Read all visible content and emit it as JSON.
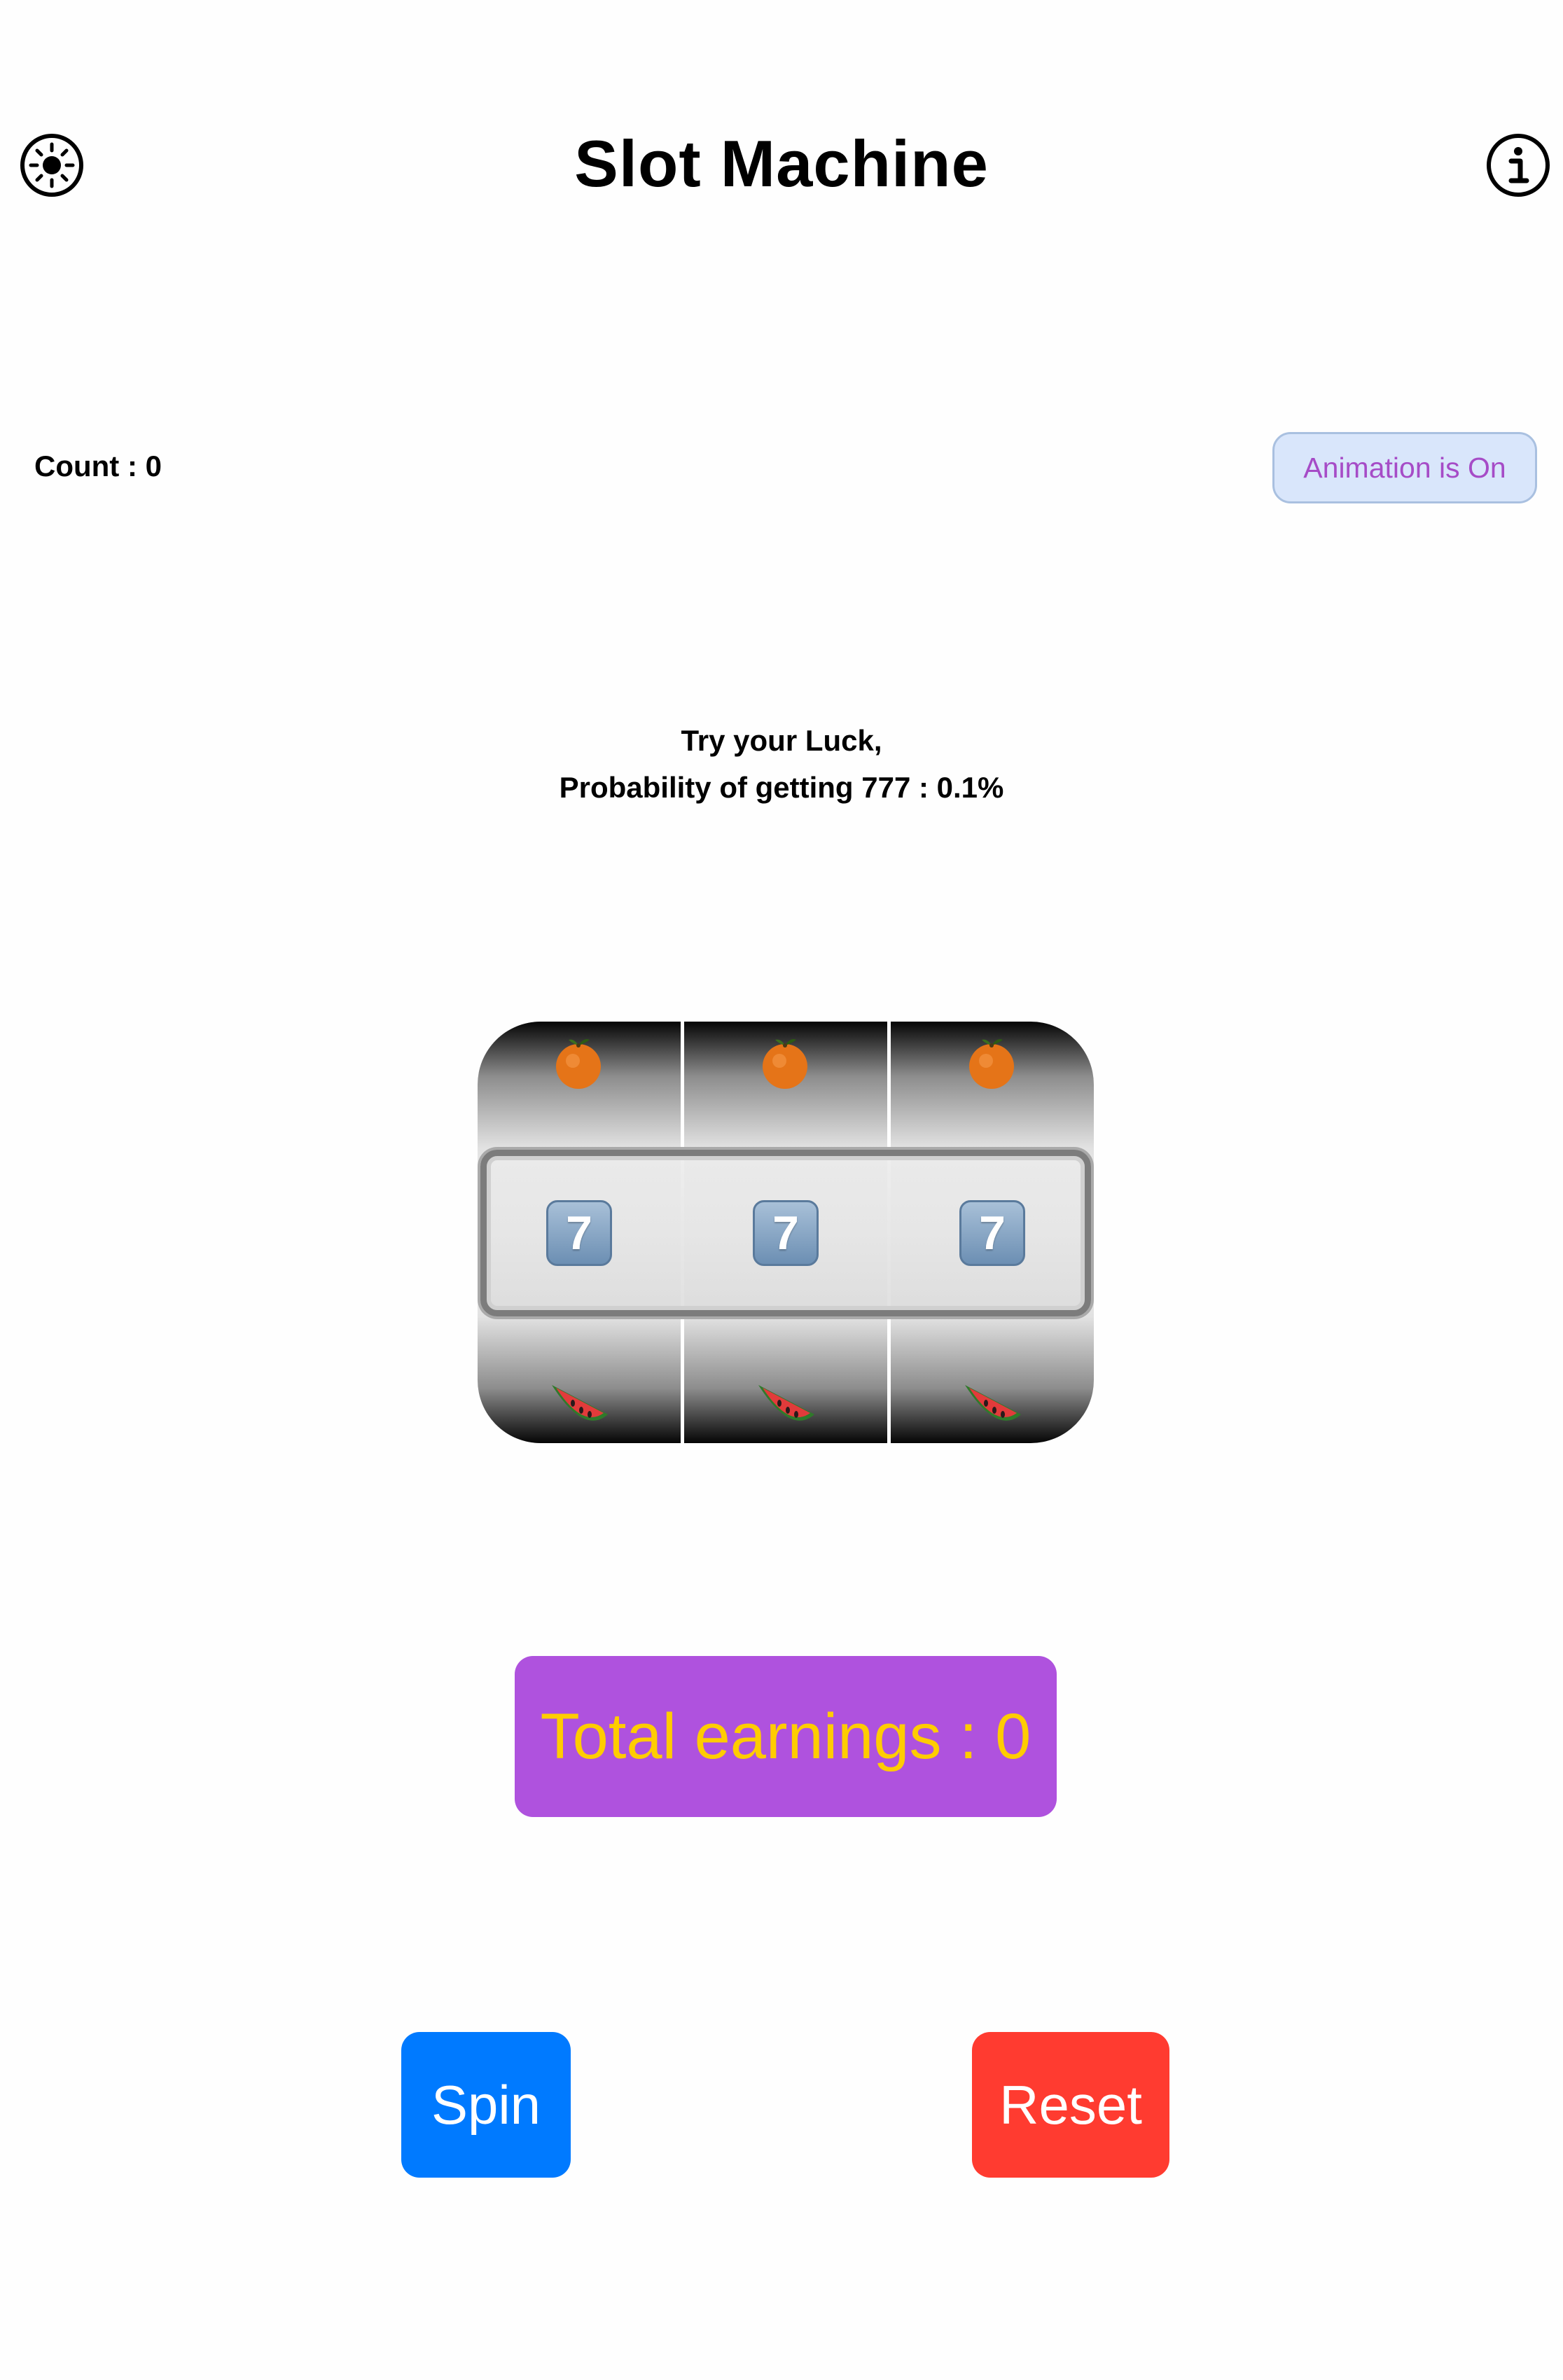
{
  "header": {
    "title": "Slot Machine",
    "left_icon": "sun-icon",
    "right_icon": "info-icon"
  },
  "count_label": "Count : 0",
  "animation_button": "Animation is On",
  "message": {
    "line1": "Try your Luck,",
    "line2": "Probability of getting 777 : 0.1%"
  },
  "reels": [
    {
      "top": "orange",
      "middle": "7",
      "bottom": "watermelon"
    },
    {
      "top": "orange",
      "middle": "7",
      "bottom": "watermelon"
    },
    {
      "top": "orange",
      "middle": "7",
      "bottom": "watermelon"
    }
  ],
  "earnings_label": "Total earnings : 0",
  "buttons": {
    "spin": "Spin",
    "reset": "Reset"
  },
  "colors": {
    "spin": "#007aff",
    "reset": "#ff3b30",
    "earnings_bg": "#af52de",
    "earnings_text": "#ffcc00",
    "animation_text": "#a64cc7"
  }
}
